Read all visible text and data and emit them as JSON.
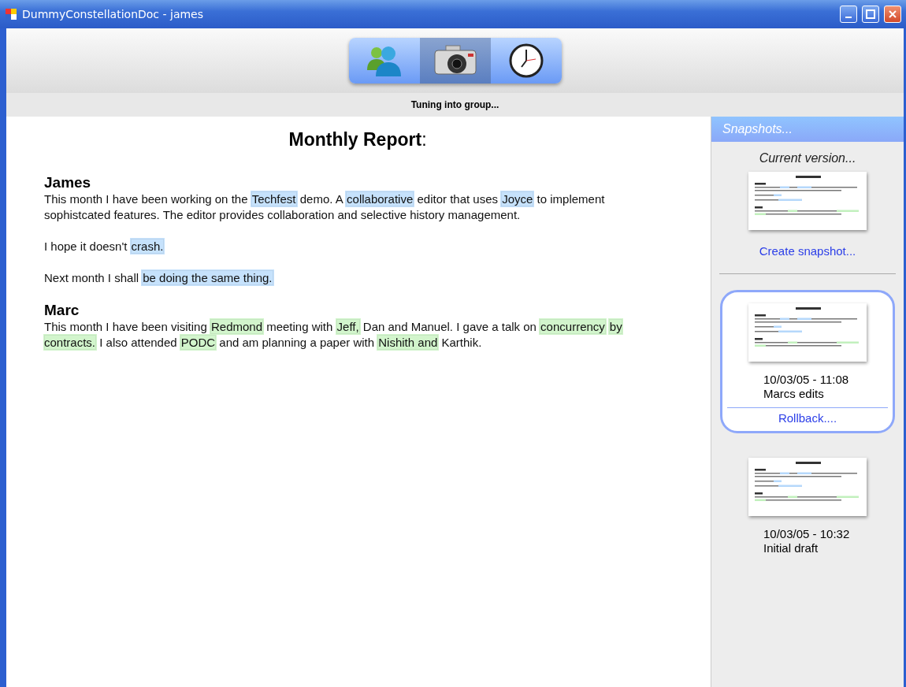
{
  "window": {
    "title": "DummyConstellationDoc - james"
  },
  "toolbar": {
    "buttons": [
      {
        "kind": "people",
        "selected": false
      },
      {
        "kind": "camera",
        "selected": true
      },
      {
        "kind": "clock",
        "selected": false
      }
    ]
  },
  "status": "Tuning into group...",
  "document": {
    "title": "**Monthly Report**:",
    "sections": [
      {
        "author": "James",
        "color": "#c6e2fc",
        "paragraphs": [
          [
            {
              "text": "This month I have been working on the "
            },
            {
              "text": "Techfest",
              "highlighted": true
            },
            {
              "text": " demo. A "
            },
            {
              "text": "collaborative",
              "highlighted": true
            },
            {
              "text": " editor that uses "
            },
            {
              "text": "Joyce",
              "highlighted": true
            },
            {
              "text": " to implement sophistcated features. The editor provides collaboration and selective history management."
            }
          ],
          [
            {
              "text": "I hope it doesn't "
            },
            {
              "text": "crash.",
              "highlighted": true
            }
          ],
          [
            {
              "text": "Next month I shall "
            },
            {
              "text": "be doing the same thing.",
              "highlighted": true
            }
          ]
        ]
      },
      {
        "author": "Marc",
        "color": "#d2f5cc",
        "paragraphs": [
          [
            {
              "text": "This month I have been visiting "
            },
            {
              "text": "Redmond",
              "highlighted": true
            },
            {
              "text": " meeting with "
            },
            {
              "text": "Jeff,",
              "highlighted": true
            },
            {
              "text": " Dan and Manuel. I gave a talk on "
            },
            {
              "text": "concurrency",
              "highlighted": true
            },
            {
              "text": "by contracts.",
              "highlighted": true
            },
            {
              "text": " I also attended "
            },
            {
              "text": "PODC",
              "highlighted": true
            },
            {
              "text": " and am planning a paper with "
            },
            {
              "text": "Nishith and",
              "highlighted": true
            },
            {
              "text": " Karthik."
            }
          ]
        ]
      }
    ]
  },
  "snapshots": {
    "header": "Snapshots...",
    "current_label": "Current version...",
    "create_link": "Create snapshot...",
    "items": [
      {
        "date": "10/03/05 - 11:08",
        "label": "Marcs edits",
        "selected": true,
        "action": "Rollback...."
      },
      {
        "date": "10/03/05 - 10:32",
        "label": "Initial draft",
        "selected": false
      }
    ]
  }
}
